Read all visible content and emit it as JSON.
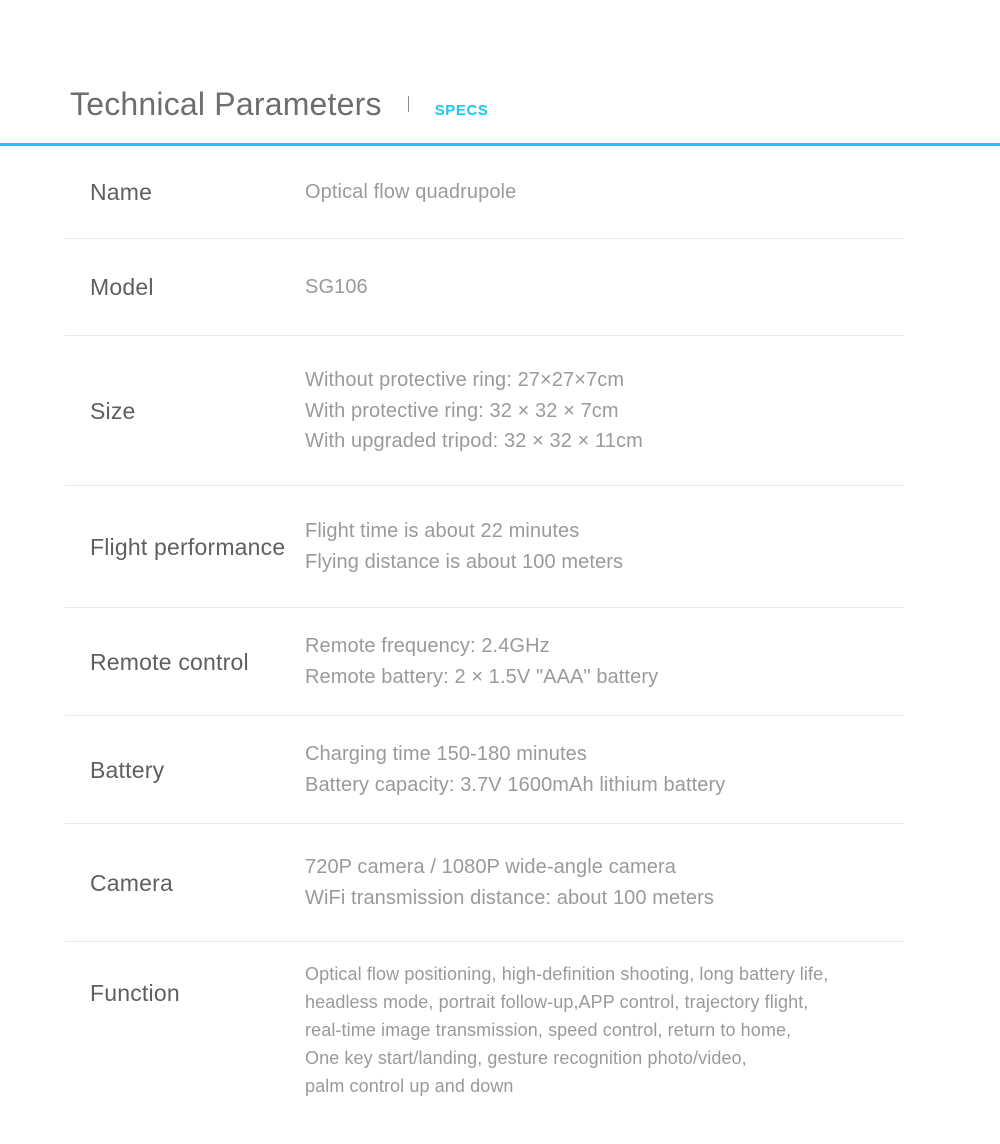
{
  "header": {
    "title": "Technical Parameters",
    "separator": "|",
    "badge": "SPECS",
    "badge_color": "#18c8f0",
    "rule_color": "#18c8f0",
    "title_color": "#6e6e6e"
  },
  "colors": {
    "label": "#5f5f5f",
    "value": "#9a9a9a",
    "divider": "#e8e8e8",
    "accent": "#18c8f0",
    "background": "#ffffff"
  },
  "spec_rows": [
    {
      "label": "Name",
      "lines": [
        "Optical flow quadrupole"
      ]
    },
    {
      "label": "Model",
      "lines": [
        "SG106"
      ]
    },
    {
      "label": "Size",
      "lines": [
        "Without protective ring: 27×27×7cm",
        "With protective ring: 32 × 32 × 7cm",
        "With upgraded tripod: 32 × 32 × 11cm"
      ]
    },
    {
      "label": "Flight performance",
      "lines": [
        "Flight time is about 22 minutes",
        "Flying distance is about 100 meters"
      ]
    },
    {
      "label": "Remote control",
      "lines": [
        "Remote frequency: 2.4GHz",
        "Remote battery: 2 × 1.5V \"AAA\" battery"
      ]
    },
    {
      "label": "Battery",
      "lines": [
        "Charging time 150-180 minutes",
        "Battery capacity: 3.7V 1600mAh lithium battery"
      ]
    },
    {
      "label": "Camera",
      "lines": [
        "720P camera / 1080P wide-angle camera",
        "WiFi transmission distance: about 100 meters"
      ]
    },
    {
      "label": "Function",
      "lines": [
        "Optical flow positioning, high-definition shooting, long battery life,",
        "headless mode, portrait follow-up,APP control, trajectory flight,",
        "real-time image transmission, speed control, return to home,",
        "One key start/landing, gesture recognition photo/video,",
        "palm control up and down"
      ]
    }
  ]
}
